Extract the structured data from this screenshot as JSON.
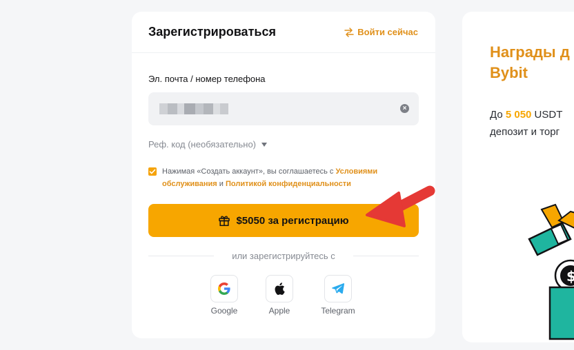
{
  "signup": {
    "title": "Зарегистрироваться",
    "login_link": "Войти сейчас",
    "field_label": "Эл. почта / номер телефона",
    "email_value": "",
    "referral_label": "Реф. код (необязательно)",
    "consent_text": "Нажимая «Создать аккаунт», вы соглашаетесь с",
    "terms_link": "Условиями обслуживания",
    "and_text": "и",
    "privacy_link": "Политикой конфиденциальности",
    "checkbox_checked": true,
    "cta_label": "$5050 за регистрацию",
    "divider_text": "или зарегистрируйтесь с",
    "social": [
      {
        "label": "Google",
        "icon": "google-icon"
      },
      {
        "label": "Apple",
        "icon": "apple-icon"
      },
      {
        "label": "Telegram",
        "icon": "telegram-icon"
      }
    ]
  },
  "promo": {
    "title_line1": "Награды д",
    "title_line2": "Bybit",
    "text_prefix": "До ",
    "amount": "5 050",
    "text_suffix": " USDT",
    "text_line2": "депозит и торг"
  },
  "colors": {
    "accent": "#f7a600",
    "accent_text": "#e0901a",
    "arrow": "#e53935"
  }
}
